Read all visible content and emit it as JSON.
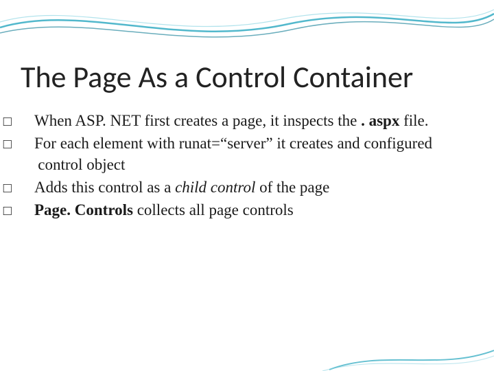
{
  "slide": {
    "title": "The Page As a Control Container",
    "bullets": [
      {
        "marker": "□",
        "segments": [
          {
            "text": "When ASP. NET first creates a page, it inspects the ",
            "style": ""
          },
          {
            "text": ". aspx",
            "style": "bold"
          },
          {
            "text": " file.",
            "style": ""
          }
        ]
      },
      {
        "marker": "□",
        "segments": [
          {
            "text": "For each element with runat=“server” it creates and configured control object",
            "style": ""
          }
        ]
      },
      {
        "marker": "□",
        "segments": [
          {
            "text": "Adds this control as a ",
            "style": ""
          },
          {
            "text": "child control",
            "style": "ital"
          },
          {
            "text": " of the page",
            "style": ""
          }
        ]
      },
      {
        "marker": "□",
        "segments": [
          {
            "text": "Page. Controls",
            "style": "bold"
          },
          {
            "text": " collects all page controls",
            "style": ""
          }
        ]
      }
    ]
  }
}
